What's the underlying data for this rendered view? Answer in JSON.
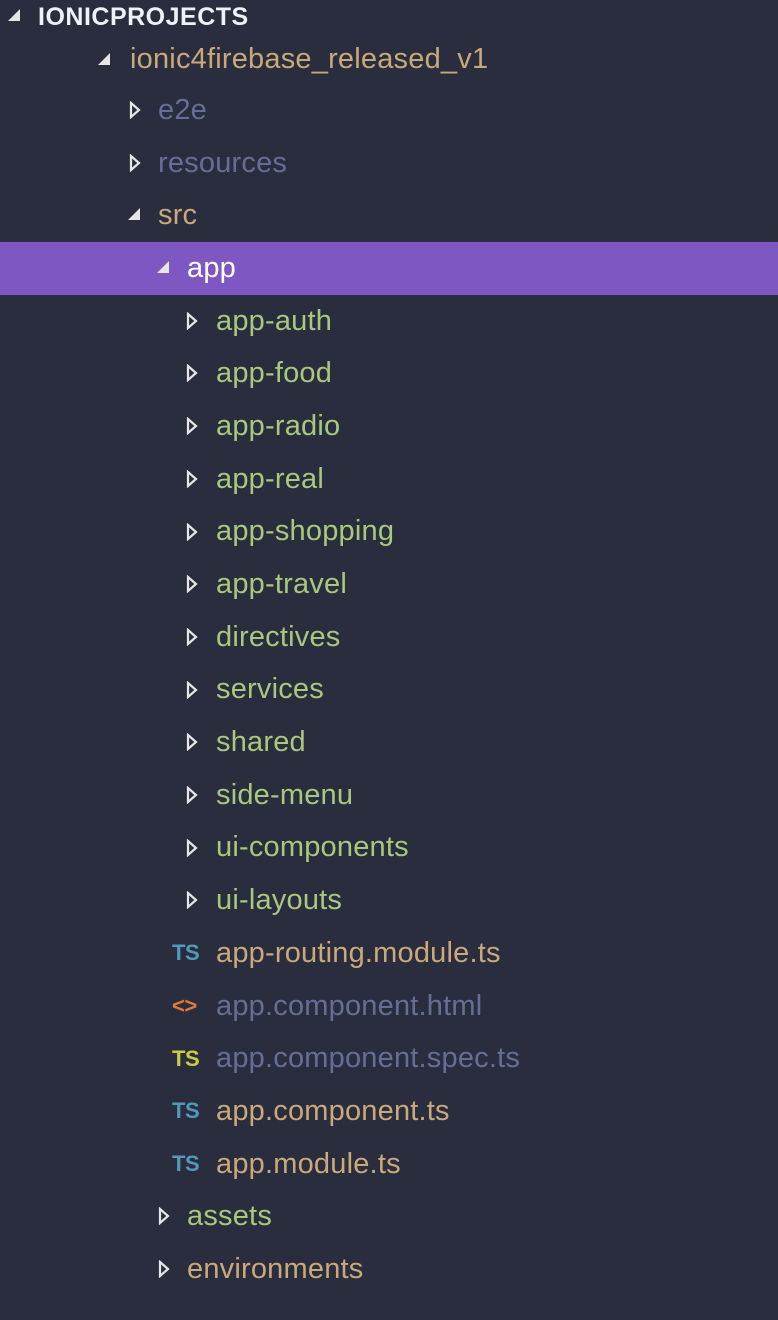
{
  "explorer": {
    "root": {
      "label": "IONICPROJECTS",
      "expanded": true
    },
    "project": {
      "label": "ionic4firebase_released_v1",
      "expanded": true
    },
    "items": [
      {
        "label": "e2e",
        "type": "folder",
        "expanded": false,
        "color": "dim",
        "depth": 2
      },
      {
        "label": "resources",
        "type": "folder",
        "expanded": false,
        "color": "dim",
        "depth": 2
      },
      {
        "label": "src",
        "type": "folder",
        "expanded": true,
        "color": "tan",
        "depth": 2
      },
      {
        "label": "app",
        "type": "folder",
        "expanded": true,
        "color": "white",
        "depth": 3,
        "selected": true
      },
      {
        "label": "app-auth",
        "type": "folder",
        "expanded": false,
        "color": "green",
        "depth": 4
      },
      {
        "label": "app-food",
        "type": "folder",
        "expanded": false,
        "color": "green",
        "depth": 4
      },
      {
        "label": "app-radio",
        "type": "folder",
        "expanded": false,
        "color": "green",
        "depth": 4
      },
      {
        "label": "app-real",
        "type": "folder",
        "expanded": false,
        "color": "green",
        "depth": 4
      },
      {
        "label": "app-shopping",
        "type": "folder",
        "expanded": false,
        "color": "green",
        "depth": 4
      },
      {
        "label": "app-travel",
        "type": "folder",
        "expanded": false,
        "color": "green",
        "depth": 4
      },
      {
        "label": "directives",
        "type": "folder",
        "expanded": false,
        "color": "green",
        "depth": 4
      },
      {
        "label": "services",
        "type": "folder",
        "expanded": false,
        "color": "green",
        "depth": 4
      },
      {
        "label": "shared",
        "type": "folder",
        "expanded": false,
        "color": "green",
        "depth": 4
      },
      {
        "label": "side-menu",
        "type": "folder",
        "expanded": false,
        "color": "green",
        "depth": 4
      },
      {
        "label": "ui-components",
        "type": "folder",
        "expanded": false,
        "color": "green",
        "depth": 4
      },
      {
        "label": "ui-layouts",
        "type": "folder",
        "expanded": false,
        "color": "green",
        "depth": 4
      },
      {
        "label": "app-routing.module.ts",
        "type": "file",
        "icon": "typescript-icon",
        "icon_text": "TS",
        "icon_color": "ts-blue",
        "color": "tan",
        "depth": 4
      },
      {
        "label": "app.component.html",
        "type": "file",
        "icon": "html-icon",
        "icon_text": "<>",
        "icon_color": "html-orange",
        "color": "dim",
        "depth": 4
      },
      {
        "label": "app.component.spec.ts",
        "type": "file",
        "icon": "typescript-test-icon",
        "icon_text": "TS",
        "icon_color": "ts-yellow",
        "color": "dim",
        "depth": 4
      },
      {
        "label": "app.component.ts",
        "type": "file",
        "icon": "typescript-icon",
        "icon_text": "TS",
        "icon_color": "ts-blue",
        "color": "tan",
        "depth": 4
      },
      {
        "label": "app.module.ts",
        "type": "file",
        "icon": "typescript-icon",
        "icon_text": "TS",
        "icon_color": "ts-blue",
        "color": "tan",
        "depth": 4
      },
      {
        "label": "assets",
        "type": "folder",
        "expanded": false,
        "color": "green",
        "depth": 3
      },
      {
        "label": "environments",
        "type": "folder",
        "expanded": false,
        "color": "tan",
        "depth": 3
      }
    ]
  },
  "colors": {
    "background": "#292d3e",
    "selected": "#7e57c2",
    "tan": "#c9a97a",
    "dim": "#676e95",
    "green": "#a9c77d",
    "ts_blue": "#519aba",
    "ts_yellow": "#cbcb41",
    "html_orange": "#e37933"
  }
}
